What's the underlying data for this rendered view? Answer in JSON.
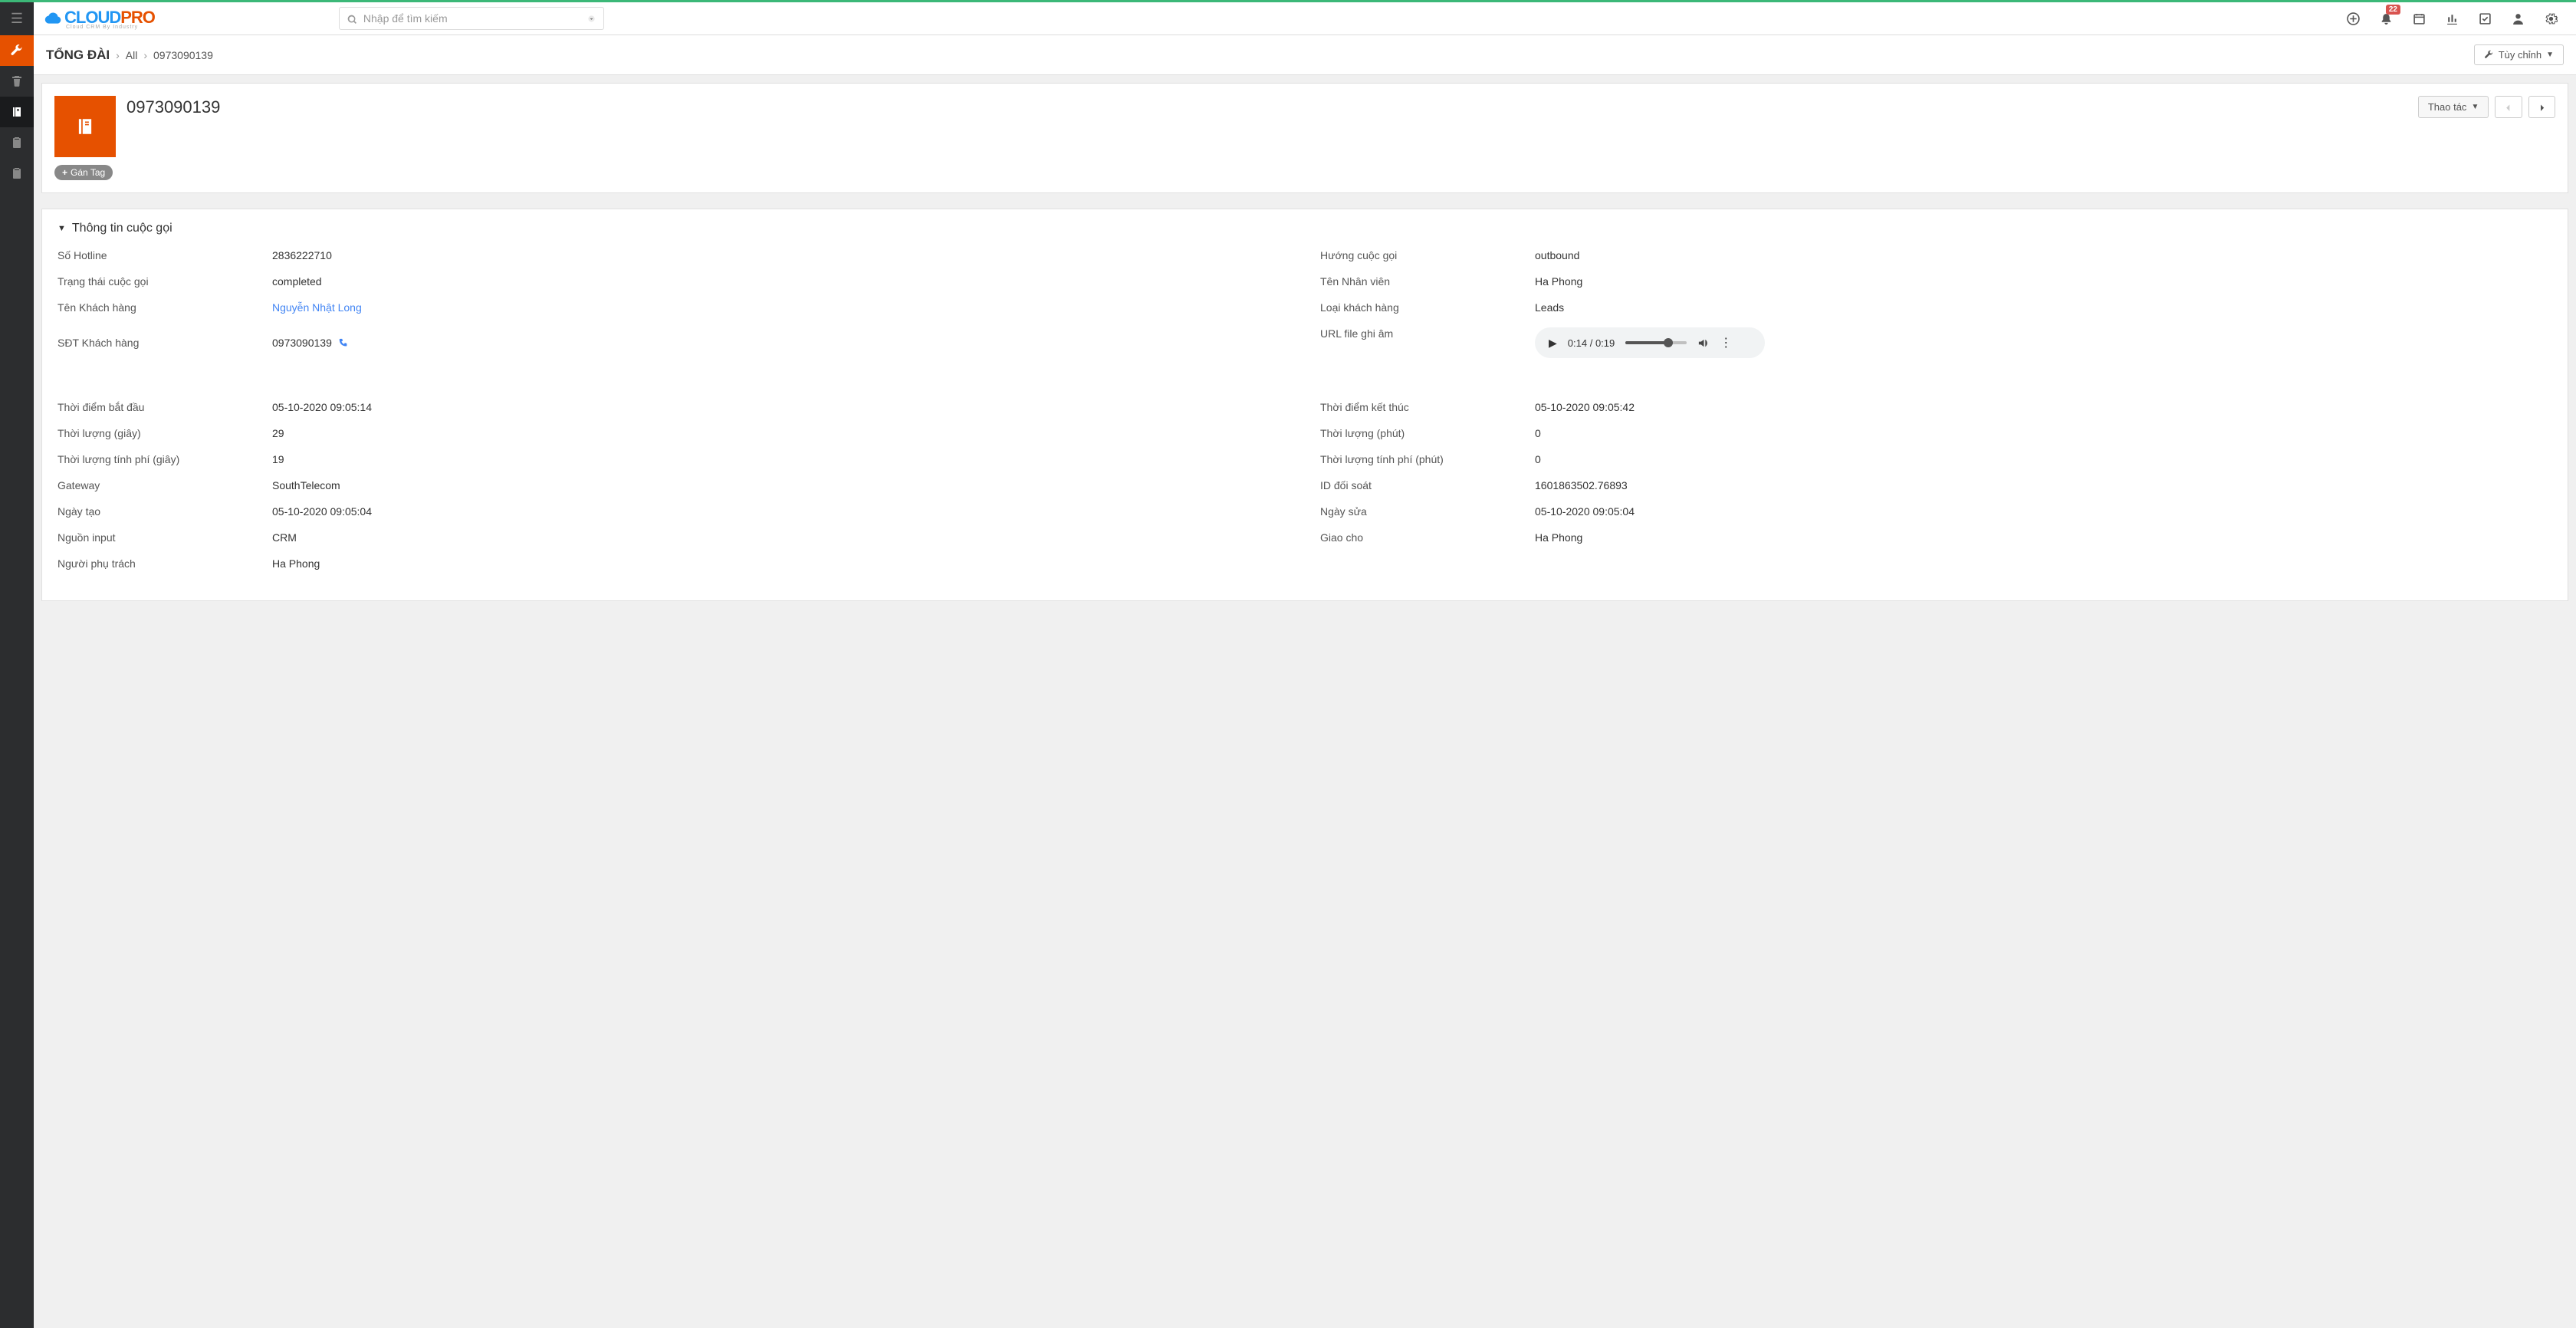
{
  "brand": {
    "cloud": "CLOUD",
    "pro": "PRO",
    "tagline": "Cloud CRM By Industry"
  },
  "search": {
    "placeholder": "Nhập để tìm kiếm"
  },
  "notifications": {
    "count": "22"
  },
  "breadcrumb": {
    "module": "TỔNG ĐÀI",
    "all": "All",
    "record": "0973090139"
  },
  "customize_label": "Tùy chỉnh",
  "record": {
    "title": "0973090139"
  },
  "actions_label": "Thao tác",
  "tag_label": "Gán Tag",
  "section": {
    "title": "Thông tin cuộc gọi"
  },
  "fields": {
    "hotline": {
      "label": "Số Hotline",
      "value": "2836222710"
    },
    "direction": {
      "label": "Hướng cuộc gọi",
      "value": "outbound"
    },
    "call_status": {
      "label": "Trạng thái cuộc gọi",
      "value": "completed"
    },
    "employee": {
      "label": "Tên Nhân viên",
      "value": "Ha Phong"
    },
    "customer_name": {
      "label": "Tên Khách hàng",
      "value": "Nguyễn Nhật Long"
    },
    "customer_type": {
      "label": "Loại khách hàng",
      "value": "Leads"
    },
    "customer_phone": {
      "label": "SĐT Khách hàng",
      "value": "0973090139"
    },
    "recording": {
      "label": "URL file ghi âm"
    },
    "start_time": {
      "label": "Thời điểm bắt đầu",
      "value": "05-10-2020 09:05:14"
    },
    "end_time": {
      "label": "Thời điểm kết thúc",
      "value": "05-10-2020 09:05:42"
    },
    "dur_sec": {
      "label": "Thời lượng (giây)",
      "value": "29"
    },
    "dur_min": {
      "label": "Thời lượng (phút)",
      "value": "0"
    },
    "bill_sec": {
      "label": "Thời lượng tính phí (giây)",
      "value": "19"
    },
    "bill_min": {
      "label": "Thời lượng tính phí (phút)",
      "value": "0"
    },
    "gateway": {
      "label": "Gateway",
      "value": "SouthTelecom"
    },
    "recon_id": {
      "label": "ID đối soát",
      "value": "1601863502.76893"
    },
    "created": {
      "label": "Ngày tạo",
      "value": "05-10-2020 09:05:04"
    },
    "modified": {
      "label": "Ngày sửa",
      "value": "05-10-2020 09:05:04"
    },
    "source": {
      "label": "Nguồn input",
      "value": "CRM"
    },
    "assigned": {
      "label": "Giao cho",
      "value": "Ha Phong"
    },
    "owner": {
      "label": "Người phụ trách",
      "value": "Ha Phong"
    }
  },
  "audio": {
    "current": "0:14",
    "total": "0:19"
  }
}
